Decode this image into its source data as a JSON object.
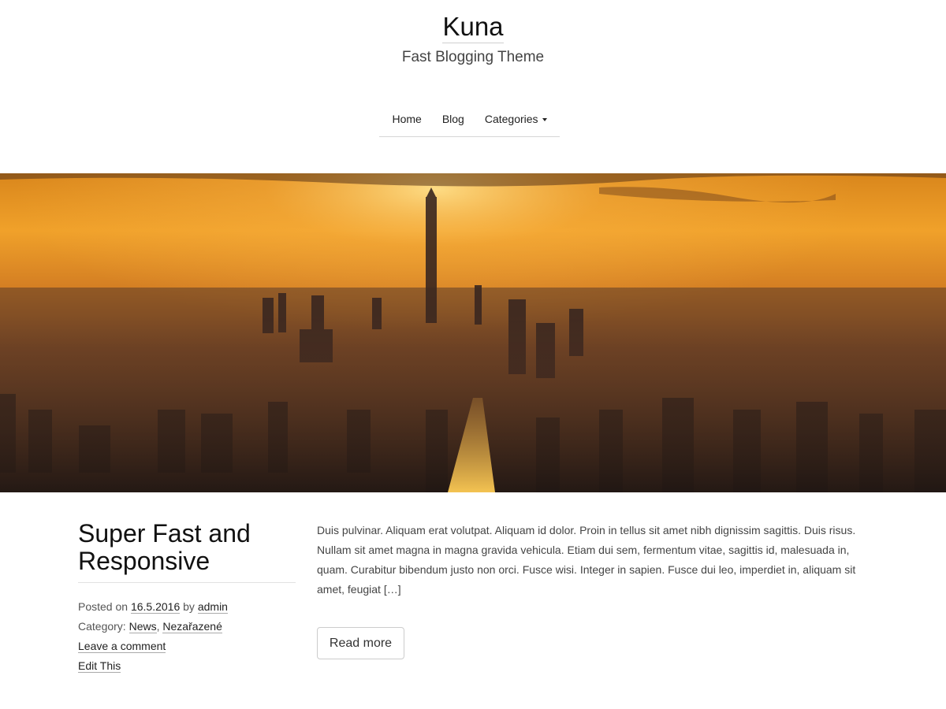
{
  "site": {
    "title": "Kuna",
    "description": "Fast Blogging Theme"
  },
  "nav": {
    "items": [
      {
        "label": "Home"
      },
      {
        "label": "Blog"
      },
      {
        "label": "Categories"
      }
    ]
  },
  "hero": {
    "alt": "City skyline at sunset"
  },
  "post": {
    "title": "Super Fast and Responsive",
    "posted_on_label": "Posted on",
    "date": "16.5.2016",
    "by_label": "by",
    "author": "admin",
    "category_label": "Category:",
    "categories": [
      "News",
      "Nezařazené"
    ],
    "category_separator": ",",
    "comment_link": "Leave a comment",
    "edit_link": "Edit This",
    "excerpt": "Duis pulvinar. Aliquam erat volutpat. Aliquam id dolor. Proin in tellus sit amet nibh dignissim sagittis. Duis risus. Nullam sit amet magna in magna gravida vehicula. Etiam dui sem, fermentum vitae, sagittis id, malesuada in, quam. Curabitur bibendum justo non orci. Fusce wisi. Integer in sapien. Fusce dui leo, imperdiet in, aliquam sit amet, feugiat […]",
    "read_more": "Read more"
  }
}
